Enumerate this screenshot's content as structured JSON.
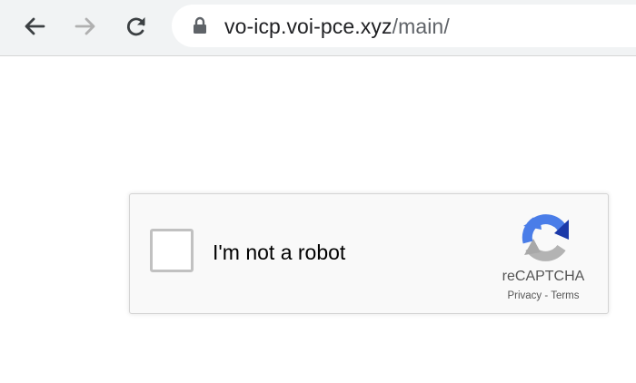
{
  "browser": {
    "url_host": "vo-icp.voi-pce.xyz",
    "url_path": "/main/"
  },
  "captcha": {
    "label": "I'm not a robot",
    "brand": "reCAPTCHA",
    "privacy_link": "Privacy",
    "separator": " - ",
    "terms_link": "Terms",
    "checked": false
  },
  "icons": [
    "back-arrow-icon",
    "forward-arrow-icon",
    "reload-icon",
    "lock-icon",
    "recaptcha-logo-icon"
  ],
  "colors": {
    "toolbar_bg": "#f1f3f4",
    "forward_disabled": "#b0b0b0",
    "recaptcha_blue": "#4a7de8",
    "recaptcha_dark": "#1c3aa9",
    "recaptcha_gray": "#b3b3b3"
  }
}
